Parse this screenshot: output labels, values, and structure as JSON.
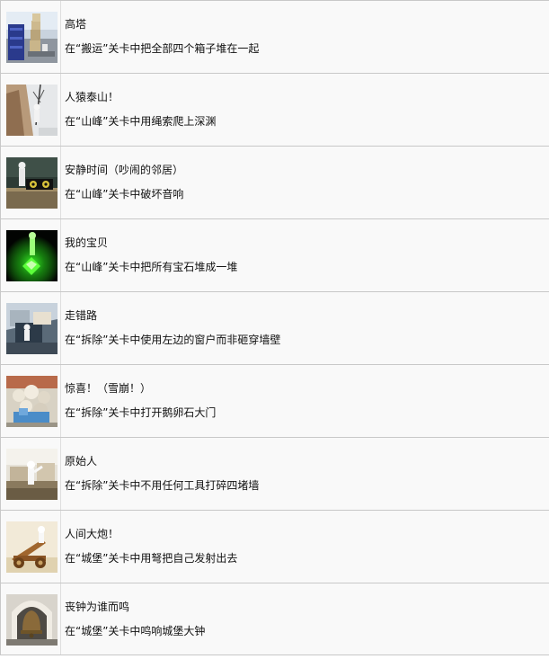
{
  "achievements": [
    {
      "title": "高塔",
      "description": "在“搬运”关卡中把全部四个箱子堆在一起",
      "thumbnail": "tower-thumbnail"
    },
    {
      "title": "人猿泰山！",
      "description": "在“山峰”关卡中用绳索爬上深渊",
      "thumbnail": "rope-climb-thumbnail"
    },
    {
      "title": "安静时间（吵闹的邻居）",
      "description": "在“山峰”关卡中破坏音响",
      "thumbnail": "speaker-thumbnail"
    },
    {
      "title": "我的宝贝",
      "description": "在“山峰”关卡中把所有宝石堆成一堆",
      "thumbnail": "green-gem-thumbnail"
    },
    {
      "title": "走错路",
      "description": "在“拆除”关卡中使用左边的窗户而非砸穿墙壁",
      "thumbnail": "window-thumbnail"
    },
    {
      "title": "惊喜！（雪崩！）",
      "description": "在“拆除”关卡中打开鹅卵石大门",
      "thumbnail": "avalanche-thumbnail"
    },
    {
      "title": "原始人",
      "description": "在“拆除”关卡中不用任何工具打碎四堵墙",
      "thumbnail": "caveman-thumbnail"
    },
    {
      "title": "人间大炮！",
      "description": "在“城堡”关卡中用弩把自己发射出去",
      "thumbnail": "catapult-thumbnail"
    },
    {
      "title": "丧钟为谁而鸣",
      "description": "在“城堡”关卡中鸣响城堡大钟",
      "thumbnail": "bell-thumbnail"
    }
  ]
}
